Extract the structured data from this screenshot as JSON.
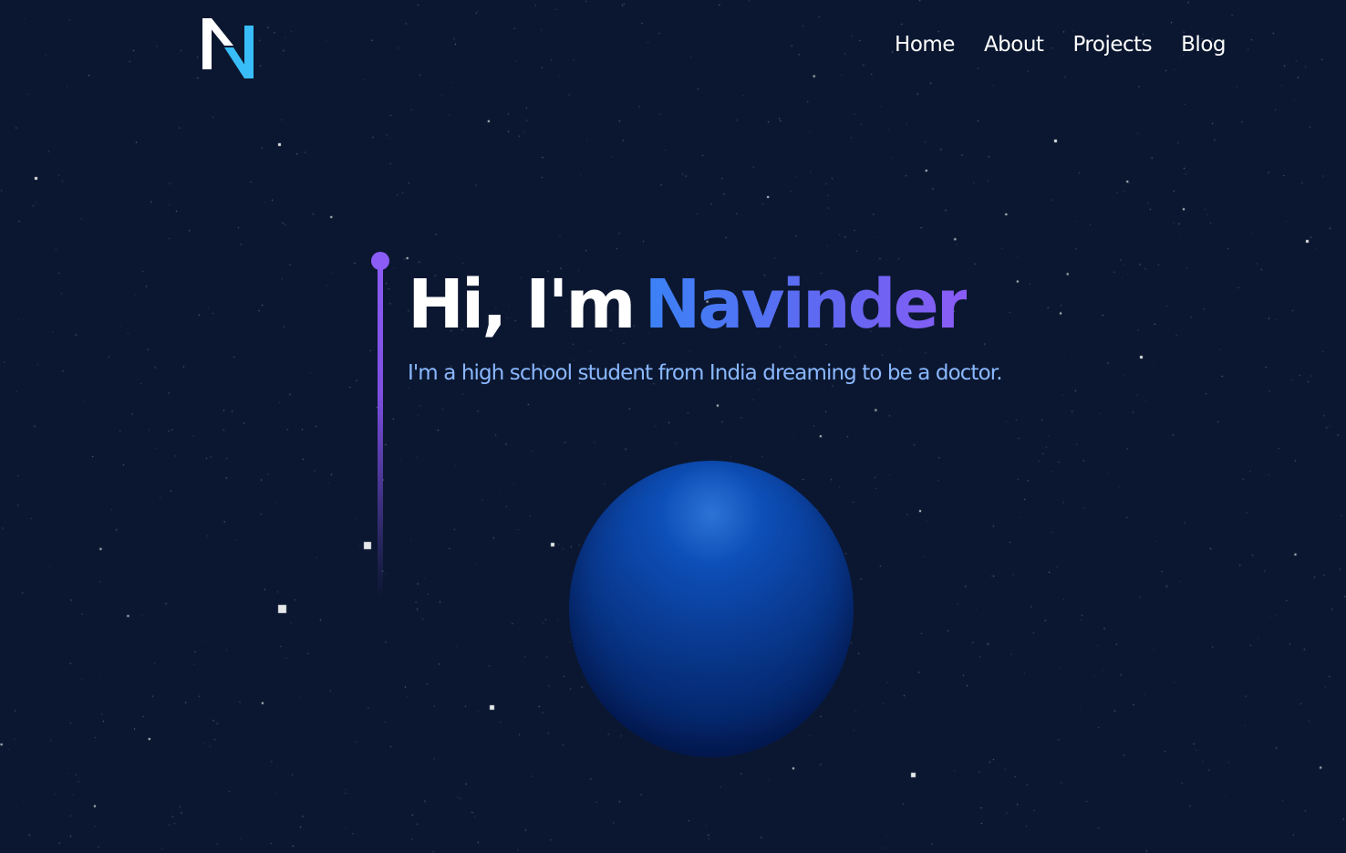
{
  "nav": {
    "items": [
      {
        "label": "Home"
      },
      {
        "label": "About"
      },
      {
        "label": "Projects"
      },
      {
        "label": "Blog"
      }
    ]
  },
  "hero": {
    "greeting": "Hi, I'm",
    "name": "Navinder",
    "tagline": "I'm a high school student from India dreaming to be a doctor."
  },
  "icons": {
    "logo": "n-logo-icon"
  },
  "colors": {
    "background": "#0b1730",
    "accent_blue": "#3b82f6",
    "accent_purple": "#8b5cf6",
    "tagline": "#8ab8ff",
    "planet": "#0a3e99",
    "logo_white": "#ffffff",
    "logo_blue": "#38bdf8"
  }
}
